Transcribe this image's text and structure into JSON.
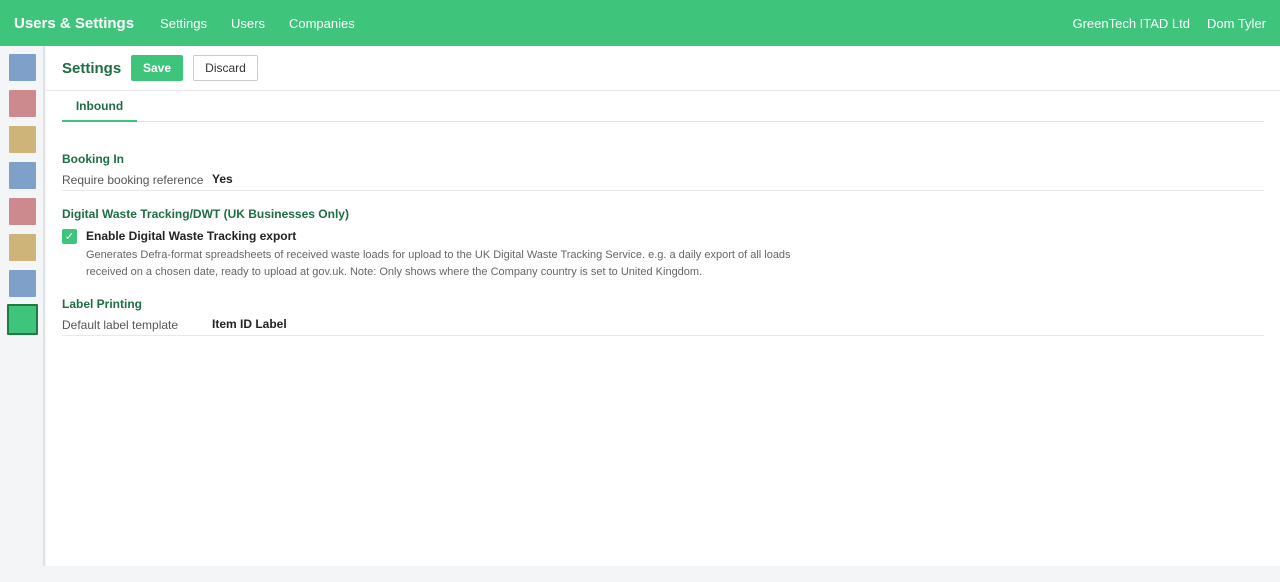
{
  "topbar": {
    "brand": "Users & Settings",
    "nav": [
      "Settings",
      "Users",
      "Companies"
    ],
    "company": "GreenTech ITAD Ltd",
    "user": "Dom Tyler",
    "color": "#3ec47b"
  },
  "sidebar": {
    "tiles": [
      {
        "color": "#7fa1c9"
      },
      {
        "color": "#cc8a8e"
      },
      {
        "color": "#cfb47a"
      },
      {
        "color": "#7fa1c9"
      },
      {
        "color": "#cc8a8e"
      },
      {
        "color": "#cfb47a"
      },
      {
        "color": "#7fa1c9"
      },
      {
        "color": "#3ec47b",
        "active": true
      }
    ]
  },
  "page": {
    "title": "Settings",
    "save_label": "Save",
    "discard_label": "Discard"
  },
  "tabs": [
    {
      "label": "Inbound",
      "active": true
    }
  ],
  "booking": {
    "title": "Booking In",
    "label": "Require booking reference",
    "value": "Yes"
  },
  "dwt": {
    "title": "Digital Waste Tracking/DWT (UK Businesses Only)",
    "checkbox_checked": true,
    "checkbox_label": "Enable Digital Waste Tracking export",
    "help_line1": "Generates Defra-format spreadsheets of received waste loads for upload to the UK Digital Waste Tracking Service. e.g. a daily export of all loads",
    "help_line2": "received on a chosen date, ready to upload at gov.uk. Note: Only shows where the Company country is set to United Kingdom."
  },
  "label_printing": {
    "title": "Label Printing",
    "label": "Default label template",
    "value": "Item ID Label"
  }
}
